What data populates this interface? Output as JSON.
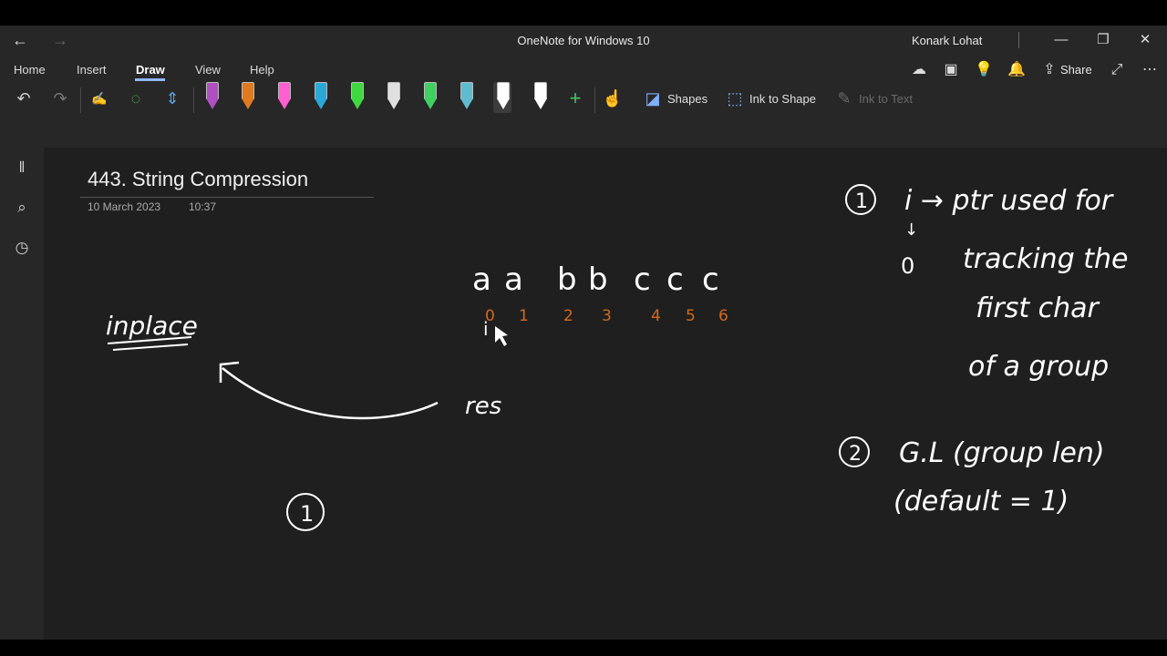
{
  "window": {
    "title": "OneNote for Windows 10",
    "user": "Konark Lohat",
    "back_icon": "back-arrow-icon",
    "forward_icon": "forward-arrow-icon"
  },
  "ribbon": {
    "tabs": [
      {
        "label": "Home"
      },
      {
        "label": "Insert"
      },
      {
        "label": "Draw"
      },
      {
        "label": "View"
      },
      {
        "label": "Help"
      }
    ],
    "active_tab": "Draw",
    "share_label": "Share",
    "tools": {
      "shapes_label": "Shapes",
      "ink_to_shape_label": "Ink to Shape",
      "ink_to_text_label": "Ink to Text"
    },
    "pen_colors": [
      "#b04fc0",
      "#e07a20",
      "#ff5fd0",
      "#2aa8d8",
      "#40d840",
      "#e0e0e0",
      "#3fd060",
      "#5fbcd0",
      "#ffffff",
      "#ffffff"
    ],
    "accent_color": "#8fb8ff"
  },
  "page": {
    "title": "443. String Compression",
    "date": "10 March 2023",
    "time": "10:37"
  },
  "ink": {
    "sequence": [
      "a",
      "a",
      "b",
      "b",
      "c",
      "c",
      "c"
    ],
    "indices": [
      "0",
      "1",
      "2",
      "3",
      "4",
      "5",
      "6"
    ],
    "index_color": "#d2691e",
    "pointer_label": "i",
    "res_label": "res",
    "inplace_label": "inplace",
    "circled_one_left": "1",
    "note1_num": "1",
    "note1_line1": "i → ptr used for",
    "note1_arrow_value": "0",
    "note1_line2": "tracking the",
    "note1_line3": "first char",
    "note1_line4": "of a group",
    "note2_num": "2",
    "note2_line1": "G.L (group len)",
    "note2_line2": "(default = 1)"
  }
}
